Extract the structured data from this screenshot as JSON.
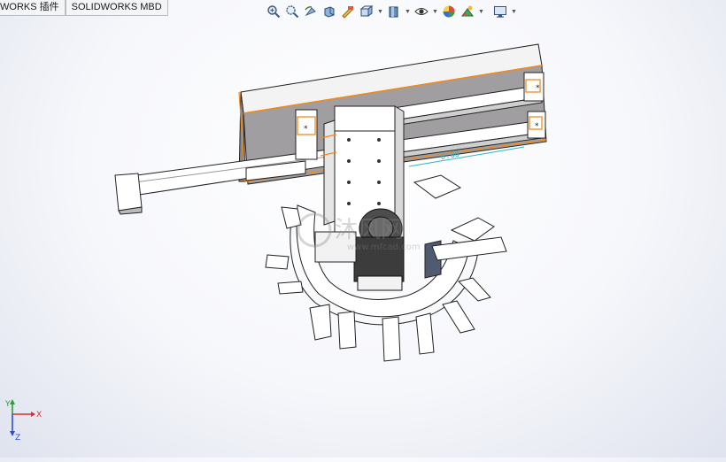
{
  "tabs": [
    {
      "label": "WORKS 插件"
    },
    {
      "label": "SOLIDWORKS MBD"
    }
  ],
  "heads_up_toolbar": {
    "icons": [
      "zoom-to-fit-icon",
      "zoom-to-area-icon",
      "previous-view-icon",
      "section-view-icon",
      "dynamic-annotation-icon",
      "view-orientation-icon",
      "display-style-icon",
      "hide-show-items-icon",
      "edit-appearance-icon",
      "apply-scene-icon",
      "view-settings-icon"
    ]
  },
  "model": {
    "dimension_text": "0.00",
    "watermark_text": "沐风网",
    "watermark_url": "www.mfcad.com"
  },
  "triad": {
    "x_label": "X",
    "y_label": "Y",
    "z_label": "Z"
  },
  "colors": {
    "selection_edge": "#f08a1c",
    "x_axis": "#d63030",
    "y_axis": "#2f9b3a",
    "z_axis": "#2c4fd3",
    "dimension": "#2bb5c4"
  }
}
